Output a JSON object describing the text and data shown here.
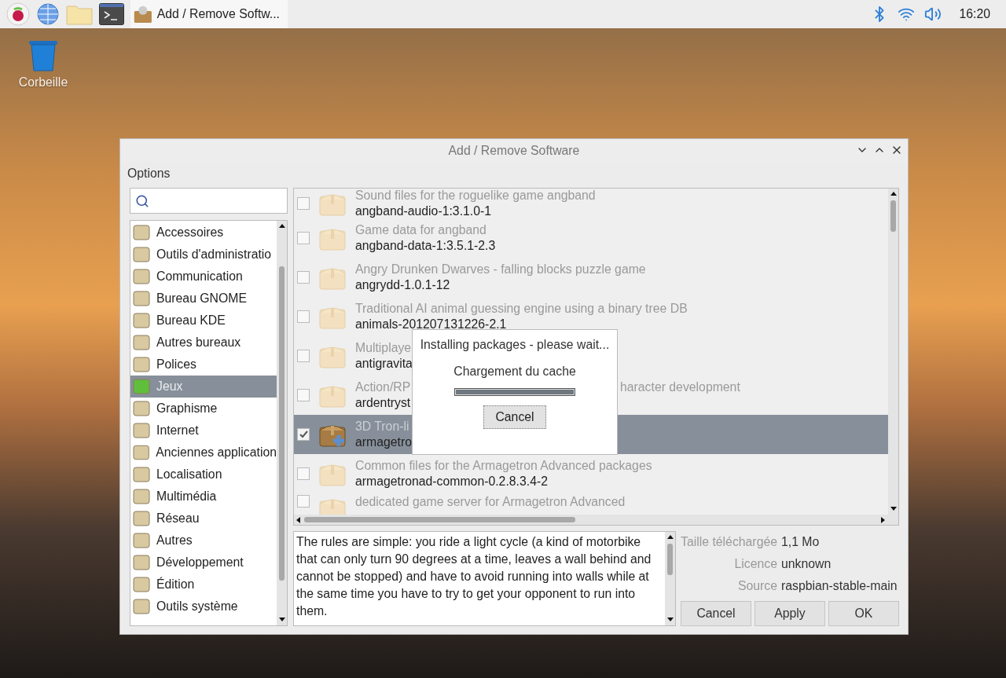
{
  "taskbar": {
    "window_button": "Add / Remove Softw...",
    "clock": "16:20"
  },
  "desktop_icons": [
    {
      "label": "Corbeille"
    }
  ],
  "window": {
    "title": "Add / Remove Software",
    "menu": [
      "Options"
    ],
    "categories": [
      {
        "label": "Accessoires",
        "selected": false
      },
      {
        "label": "Outils d'administratio",
        "selected": false
      },
      {
        "label": "Communication",
        "selected": false
      },
      {
        "label": "Bureau GNOME",
        "selected": false
      },
      {
        "label": "Bureau KDE",
        "selected": false
      },
      {
        "label": "Autres bureaux",
        "selected": false
      },
      {
        "label": "Polices",
        "selected": false
      },
      {
        "label": "Jeux",
        "selected": true
      },
      {
        "label": "Graphisme",
        "selected": false
      },
      {
        "label": "Internet",
        "selected": false
      },
      {
        "label": "Anciennes application",
        "selected": false
      },
      {
        "label": "Localisation",
        "selected": false
      },
      {
        "label": "Multimédia",
        "selected": false
      },
      {
        "label": "Réseau",
        "selected": false
      },
      {
        "label": "Autres",
        "selected": false
      },
      {
        "label": "Développement",
        "selected": false
      },
      {
        "label": "Édition",
        "selected": false
      },
      {
        "label": "Outils système",
        "selected": false
      }
    ],
    "packages": [
      {
        "description": "Sound files for the roguelike game angband",
        "name": "angband-audio-1:3.1.0-1",
        "checked": false,
        "selected": false
      },
      {
        "description": "Game data for angband",
        "name": "angband-data-1:3.5.1-2.3",
        "checked": false,
        "selected": false
      },
      {
        "description": "Angry Drunken Dwarves - falling blocks puzzle game",
        "name": "angrydd-1.0.1-12",
        "checked": false,
        "selected": false
      },
      {
        "description": "Traditional AI animal guessing engine using a binary tree DB",
        "name": "animals-201207131226-2.1",
        "checked": false,
        "selected": false
      },
      {
        "description": "Multiplaye",
        "name": "antigravita",
        "checked": false,
        "selected": false
      },
      {
        "description": "Action/RP",
        "description_tail": "haracter development",
        "name": "ardentryst",
        "checked": false,
        "selected": false
      },
      {
        "description": "3D Tron-li",
        "name": "armagetro",
        "checked": true,
        "selected": true
      },
      {
        "description": "Common files for the Armagetron Advanced packages",
        "name": "armagetronad-common-0.2.8.3.4-2",
        "checked": false,
        "selected": false
      },
      {
        "description": "dedicated game server for Armagetron Advanced",
        "checked": false,
        "selected": false
      }
    ],
    "package_text": "The rules are simple: you ride a light cycle (a kind of motorbike that can only turn 90 degrees at a time, leaves a wall behind and cannot be stopped) and have to avoid running into walls while at the same time you have to try to get your opponent to run into them.",
    "details": [
      {
        "label": "Taille téléchargée",
        "value": "1,1 Mo"
      },
      {
        "label": "Licence",
        "value": "unknown"
      },
      {
        "label": "Source",
        "value": "raspbian-stable-main"
      }
    ],
    "buttons": [
      "Cancel",
      "Apply",
      "OK"
    ],
    "dialog": {
      "title": "Installing packages - please wait...",
      "message": "Chargement du cache",
      "level": 1,
      "button": "Cancel"
    }
  }
}
